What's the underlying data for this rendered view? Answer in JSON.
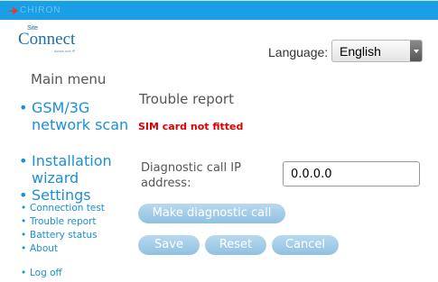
{
  "header": {
    "brand": "CHIRON",
    "bar_color": "#1a9fe6"
  },
  "logo": {
    "small": "Site",
    "main": "Connect",
    "sub": "Acces unit IP"
  },
  "language": {
    "label": "Language:",
    "selected": "English"
  },
  "sidebar": {
    "title": "Main menu",
    "items": [
      {
        "label": "GSM/3G network scan",
        "size": "large"
      },
      {
        "label": "Installation wizard",
        "size": "large"
      },
      {
        "label": "Settings",
        "size": "large"
      },
      {
        "label": "Connection test",
        "size": "small"
      },
      {
        "label": "Trouble report",
        "size": "small"
      },
      {
        "label": "Battery status",
        "size": "small"
      },
      {
        "label": "About",
        "size": "small"
      },
      {
        "label": "Log off",
        "size": "small"
      }
    ]
  },
  "main": {
    "title": "Trouble report",
    "error": "SIM card not fitted",
    "diag_label": "Diagnostic call IP address:",
    "diag_value": "0.0.0.0",
    "buttons": {
      "make_call": "Make diagnostic call",
      "save": "Save",
      "reset": "Reset",
      "cancel": "Cancel"
    }
  },
  "colors": {
    "link": "#1b8fd6",
    "error": "#dd0000",
    "button": "#a7cfe9"
  }
}
